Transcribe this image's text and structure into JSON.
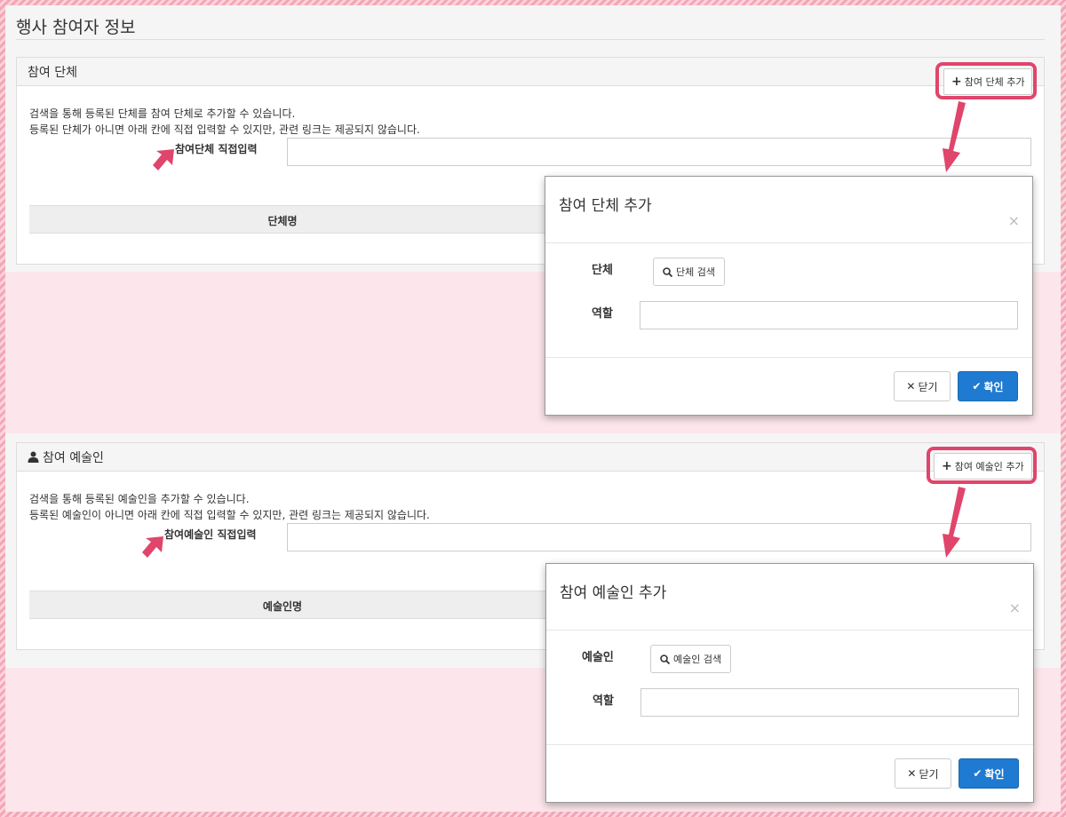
{
  "page": {
    "title": "행사 참여자 정보"
  },
  "group_section": {
    "header": "참여 단체",
    "add_button": "참여 단체 추가",
    "desc_line1": "검색을 통해 등록된 단체를 참여 단체로 추가할 수 있습니다.",
    "desc_line2": "등록된 단체가 아니면 아래 칸에 직접 입력할 수 있지만, 관련 링크는 제공되지 않습니다.",
    "direct_label": "참여단체 직접입력",
    "direct_value": "",
    "table_col1": "단체명"
  },
  "artist_section": {
    "header": "참여 예술인",
    "add_button": "참여 예술인 추가",
    "desc_line1": "검색을 통해 등록된 예술인을 추가할 수 있습니다.",
    "desc_line2": "등록된 예술인이 아니면 아래 칸에 직접 입력할 수 있지만, 관련 링크는 제공되지 않습니다.",
    "direct_label": "참여예술인 직접입력",
    "direct_value": "",
    "table_col1": "예술인명"
  },
  "group_modal": {
    "title": "참여 단체 추가",
    "close_x": "×",
    "field1_label": "단체",
    "search_button": "단체 검색",
    "field2_label": "역할",
    "role_value": "",
    "close_button": "닫기",
    "ok_button": "확인"
  },
  "artist_modal": {
    "title": "참여 예술인 추가",
    "close_x": "×",
    "field1_label": "예술인",
    "search_button": "예술인 검색",
    "field2_label": "역할",
    "role_value": "",
    "close_button": "닫기",
    "ok_button": "확인"
  },
  "colors": {
    "highlight": "#e0456c",
    "primary": "#1f7ad1",
    "arrow": "#e0456c"
  }
}
